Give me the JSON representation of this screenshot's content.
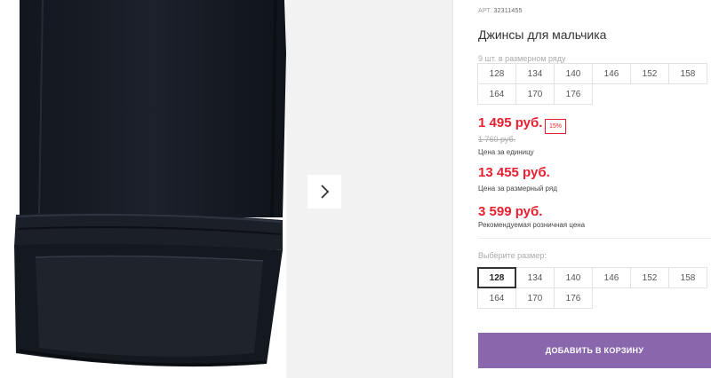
{
  "product": {
    "art_label": "АРТ.",
    "art_number": "32311455",
    "title": "Джинсы для мальчика",
    "pack_hint": "9 шт. в размерном ряду",
    "pack_sizes": [
      [
        "128",
        "134",
        "140",
        "146",
        "152",
        "158"
      ],
      [
        "164",
        "170",
        "176"
      ]
    ]
  },
  "prices": {
    "unit_price": "1 495 руб.",
    "discount_badge": "15%",
    "old_price": "1 760 руб.",
    "unit_label": "Цена за единицу",
    "range_price": "13 455 руб.",
    "range_label": "Цена за размерный ряд",
    "retail_price": "3 599 руб.",
    "retail_label": "Рекомендуемая розничная цена"
  },
  "size_select": {
    "label": "Выберите размер:",
    "selected": "128",
    "sizes": [
      [
        "128",
        "134",
        "140",
        "146",
        "152",
        "158"
      ],
      [
        "164",
        "170",
        "176"
      ]
    ]
  },
  "actions": {
    "add_to_cart": "ДОБАВИТЬ В КОРЗИНУ"
  },
  "gallery": {
    "next_icon": "chevron-right-icon",
    "image_subject": "black-jeans-leg-cuff"
  },
  "colors": {
    "price_red": "#e52030",
    "button_purple": "#8a67ad"
  }
}
